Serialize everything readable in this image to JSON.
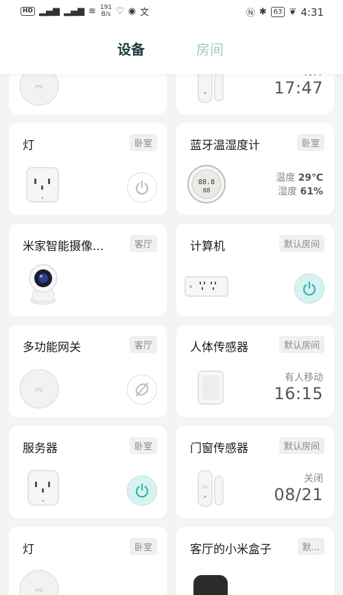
{
  "status_bar": {
    "hd": "HD",
    "signal1": "⁴ᴳ",
    "signal2": "⁴ᴳ",
    "net_speed": "191",
    "net_unit": "B/s",
    "battery": "63",
    "time": "4:31"
  },
  "tabs": {
    "devices": "设备",
    "rooms": "房间"
  },
  "cards": [
    {
      "partial_status": "打开",
      "partial_time": "17:47"
    },
    {
      "title": "灯",
      "room": "卧室"
    },
    {
      "title": "蓝牙温湿度计",
      "room": "卧室",
      "temp_label": "温度",
      "temp_value": "29℃",
      "hum_label": "湿度",
      "hum_value": "61%"
    },
    {
      "title": "米家智能摄像...",
      "room": "客厅"
    },
    {
      "title": "计算机",
      "room": "默认房间"
    },
    {
      "title": "多功能网关",
      "room": "客厅"
    },
    {
      "title": "人体传感器",
      "room": "默认房间",
      "status": "有人移动",
      "time": "16:15"
    },
    {
      "title": "服务器",
      "room": "卧室"
    },
    {
      "title": "门窗传感器",
      "room": "默认房间",
      "status": "关闭",
      "time": "08/21"
    },
    {
      "title": "灯",
      "room": "卧室"
    },
    {
      "title": "客厅的小米盒子",
      "room": "默..."
    }
  ],
  "colors": {
    "accent": "#2bb5ad",
    "accent_bg": "#d8f2f0",
    "page_bg": "#f3f4f6",
    "tab_active": "#1f3a3b",
    "tab_inactive": "#a8c4c4"
  },
  "device_logo_text": "mi",
  "thermo_display": {
    "top": "88.8",
    "bottom": "88"
  }
}
